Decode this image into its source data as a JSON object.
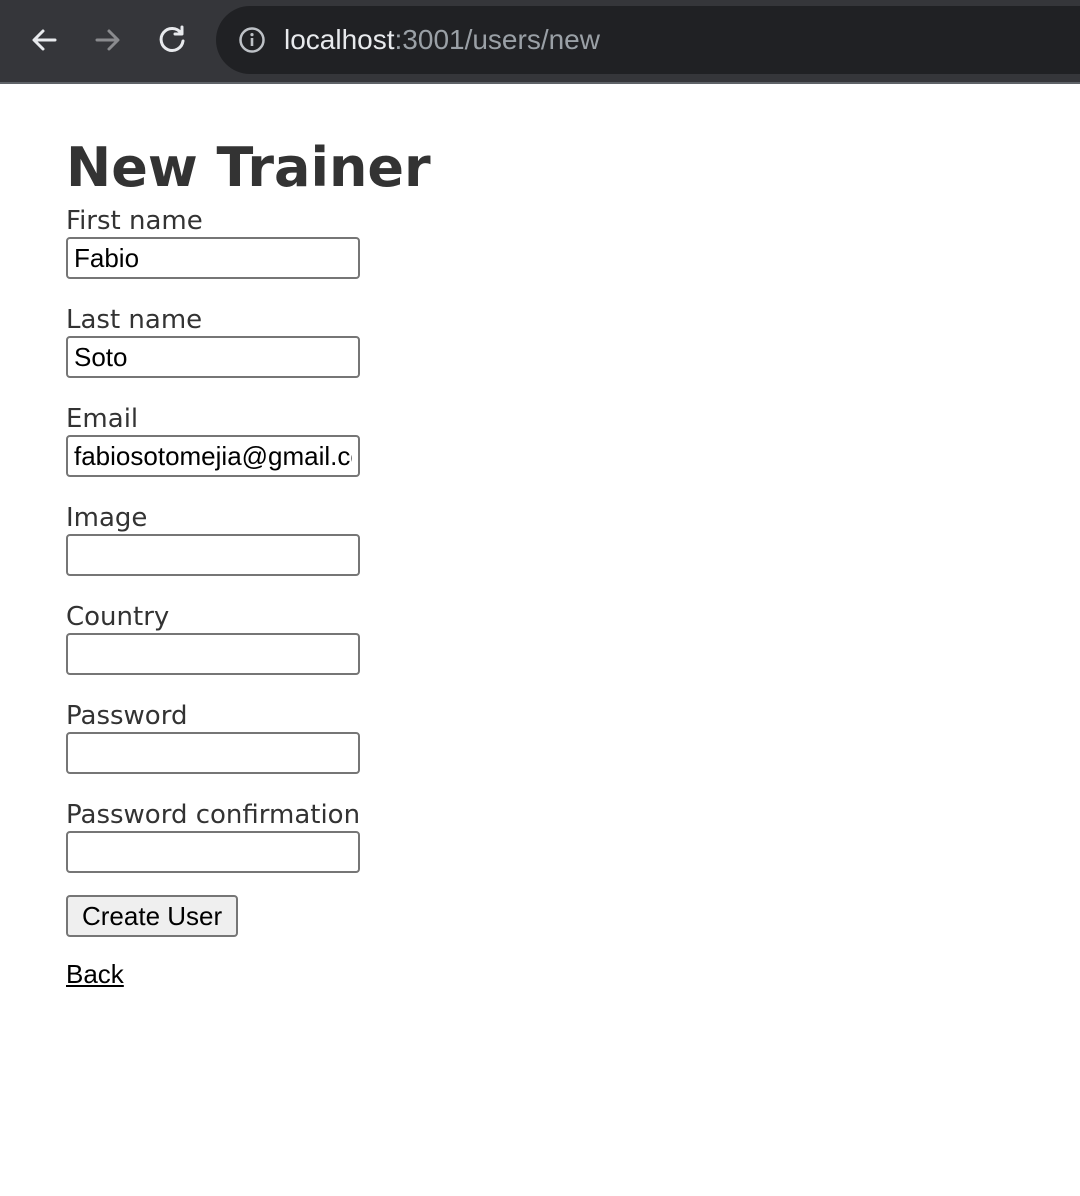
{
  "browser": {
    "url_host": "localhost",
    "url_rest": ":3001/users/new"
  },
  "page": {
    "title": "New Trainer"
  },
  "form": {
    "fields": [
      {
        "label": "First name",
        "value": "Fabio"
      },
      {
        "label": "Last name",
        "value": "Soto"
      },
      {
        "label": "Email",
        "value": "fabiosotomejia@gmail.com"
      },
      {
        "label": "Image",
        "value": ""
      },
      {
        "label": "Country",
        "value": ""
      },
      {
        "label": "Password",
        "value": ""
      },
      {
        "label": "Password confirmation",
        "value": ""
      }
    ],
    "submit_label": "Create User"
  },
  "links": {
    "back": "Back"
  },
  "colors": {
    "toolbar": "#35363a",
    "omnibox": "#202124",
    "text": "#333333"
  }
}
